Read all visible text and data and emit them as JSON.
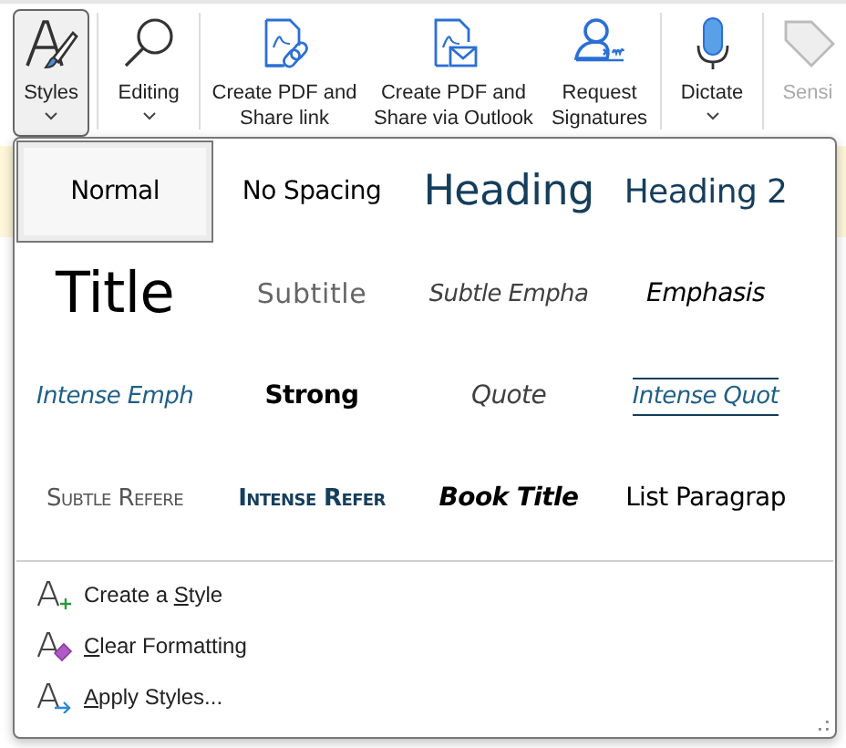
{
  "ribbon": {
    "buttons": [
      {
        "kind": "styles",
        "label": "Styles",
        "dropdown": true,
        "selected": true,
        "disabled": false
      },
      {
        "kind": "editing",
        "label": "Editing",
        "dropdown": true,
        "selected": false,
        "disabled": false
      },
      {
        "kind": "pdf-link",
        "label": "Create PDF and Share link",
        "dropdown": false,
        "selected": false,
        "disabled": false
      },
      {
        "kind": "pdf-mail",
        "label": "Create PDF and Share via Outlook",
        "dropdown": false,
        "selected": false,
        "disabled": false
      },
      {
        "kind": "signature",
        "label": "Request Signatures",
        "dropdown": false,
        "selected": false,
        "disabled": false
      },
      {
        "kind": "dictate",
        "label": "Dictate",
        "dropdown": true,
        "selected": false,
        "disabled": false
      },
      {
        "kind": "sensitivity",
        "label": "Sensi",
        "dropdown": false,
        "selected": false,
        "disabled": true
      }
    ]
  },
  "styles_gallery": {
    "items": [
      {
        "kind": "normal",
        "label": "Normal",
        "selected": true
      },
      {
        "kind": "no-spacing",
        "label": "No Spacing",
        "selected": false
      },
      {
        "kind": "heading1",
        "label": "Heading",
        "selected": false
      },
      {
        "kind": "heading2",
        "label": "Heading 2",
        "selected": false
      },
      {
        "kind": "title",
        "label": "Title",
        "selected": false
      },
      {
        "kind": "subtitle",
        "label": "Subtitle",
        "selected": false
      },
      {
        "kind": "subtle-emphasis",
        "label": "Subtle Empha",
        "selected": false
      },
      {
        "kind": "emphasis",
        "label": "Emphasis",
        "selected": false
      },
      {
        "kind": "intense-emphasis",
        "label": "Intense Emph",
        "selected": false
      },
      {
        "kind": "strong",
        "label": "Strong",
        "selected": false
      },
      {
        "kind": "quote",
        "label": "Quote",
        "selected": false
      },
      {
        "kind": "intense-quote",
        "label": "Intense Quot",
        "selected": false
      },
      {
        "kind": "subtle-reference",
        "label": "Subtle Refere",
        "selected": false
      },
      {
        "kind": "intense-reference",
        "label": "Intense Refer",
        "selected": false
      },
      {
        "kind": "book-title",
        "label": "Book Title",
        "selected": false
      },
      {
        "kind": "list-paragraph",
        "label": "List Paragrap",
        "selected": false
      }
    ]
  },
  "menu": [
    {
      "kind": "create",
      "label": {
        "before": "Create a ",
        "key": "S",
        "after": "tyle"
      }
    },
    {
      "kind": "clear",
      "label": {
        "key": "C",
        "after": "lear Formatting"
      }
    },
    {
      "kind": "apply",
      "label": {
        "key": "A",
        "after": "pply Styles..."
      }
    }
  ]
}
